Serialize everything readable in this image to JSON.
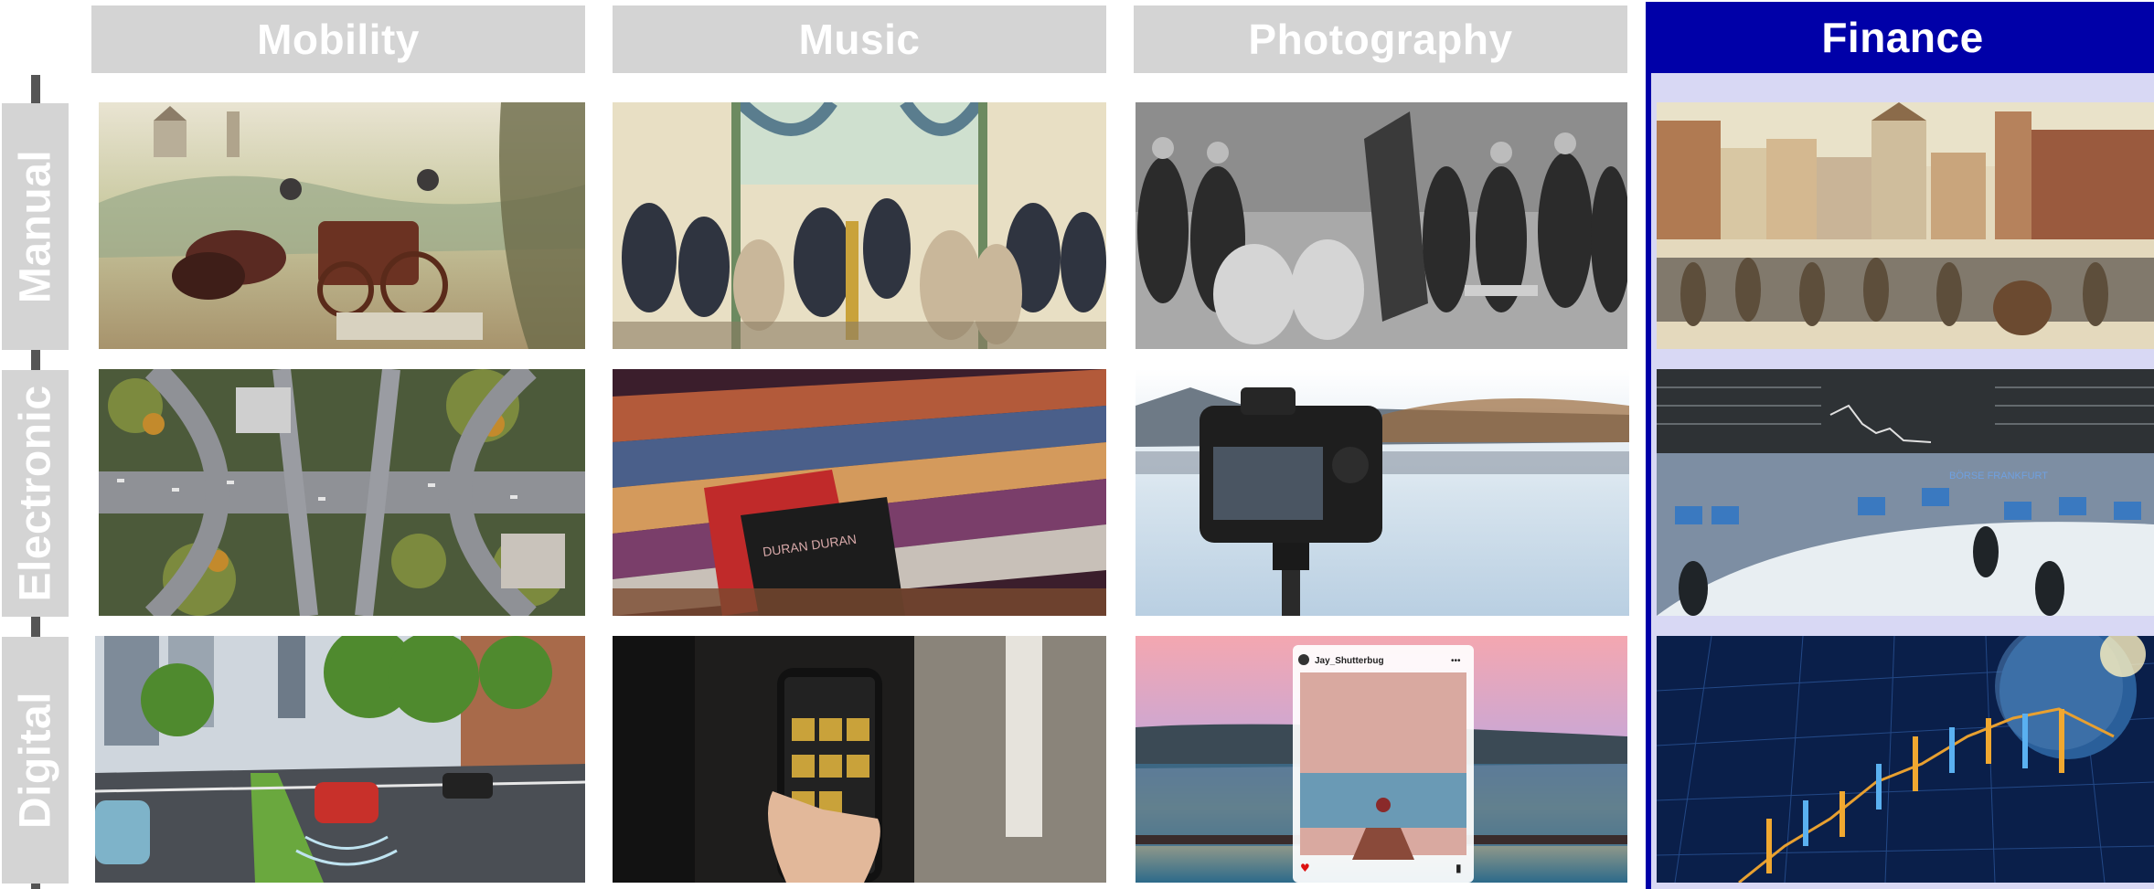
{
  "columns": [
    {
      "label": "Mobility",
      "highlighted": false
    },
    {
      "label": "Music",
      "highlighted": false
    },
    {
      "label": "Photography",
      "highlighted": false
    },
    {
      "label": "Finance",
      "highlighted": true
    }
  ],
  "rows": [
    {
      "label": "Manual"
    },
    {
      "label": "Electronic"
    },
    {
      "label": "Digital"
    }
  ],
  "photo_texts": {
    "instagram_user": "Jay_Shutterbug",
    "instagram_menu": "•••",
    "record_sleeve": "DURAN DURAN",
    "exchange_sign": "BÖRSE FRANKFURT"
  },
  "colors": {
    "header_gray": "#d4d4d4",
    "highlight_blue": "#0000a8",
    "highlight_panel": "#d8d8f4",
    "axis": "#555555"
  }
}
